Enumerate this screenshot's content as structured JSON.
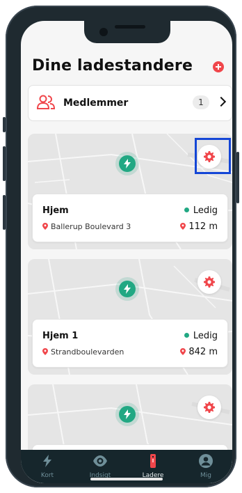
{
  "header": {
    "title": "Dine ladestandere",
    "add_icon": "plus-icon"
  },
  "members": {
    "label": "Medlemmer",
    "count": "1",
    "icon": "users-icon"
  },
  "chargers": [
    {
      "name": "Hjem",
      "status": "Ledig",
      "address": "Ballerup Boulevard 3",
      "distance": "112 m"
    },
    {
      "name": "Hjem 1",
      "status": "Ledig",
      "address": "Strandboulevarden",
      "distance": "842 m"
    }
  ],
  "tabs": [
    {
      "label": "Kort",
      "icon": "bolt-icon"
    },
    {
      "label": "Indsigt",
      "icon": "eye-icon"
    },
    {
      "label": "Ladere",
      "icon": "charger-icon"
    },
    {
      "label": "Mig",
      "icon": "profile-icon"
    }
  ],
  "colors": {
    "accent": "#f0464b",
    "status_green": "#21a883",
    "tabbar": "#16262c",
    "highlight": "#1446d6"
  }
}
